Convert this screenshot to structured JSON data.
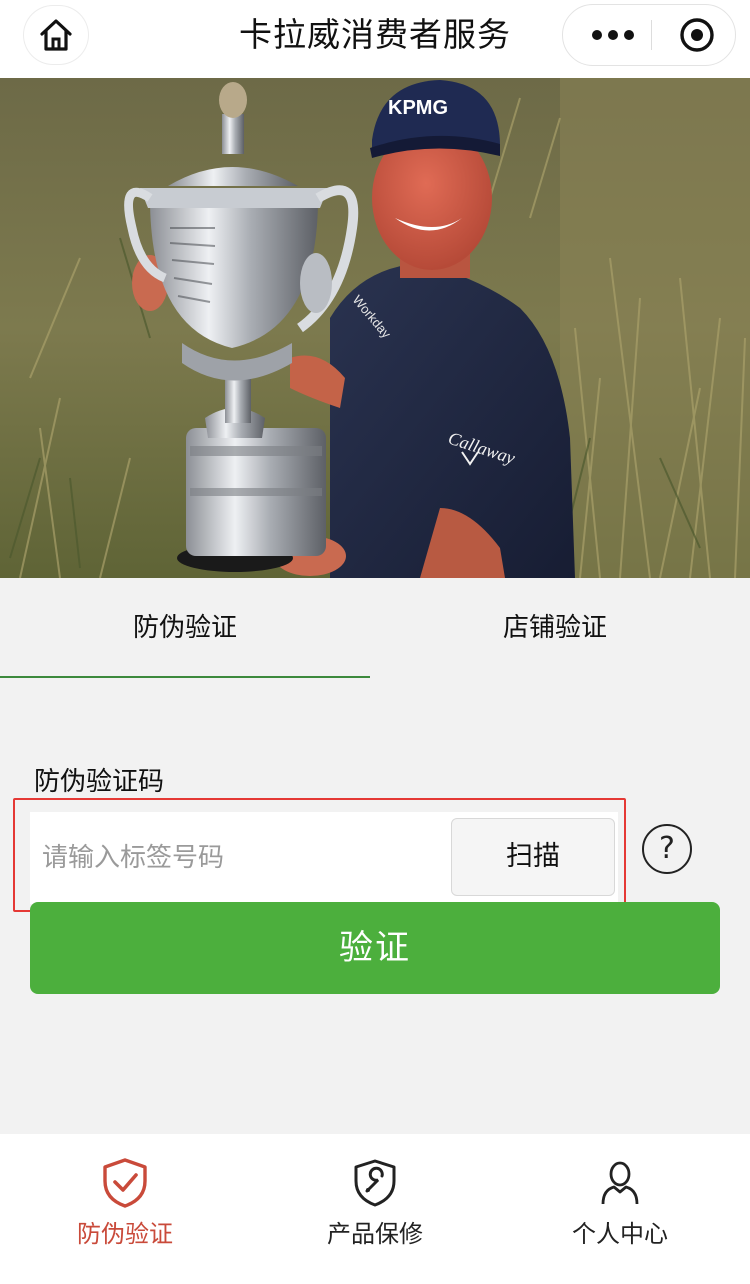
{
  "header": {
    "title": "卡拉威消费者服务",
    "home_icon": "home-icon",
    "more_icon": "more-dots-icon",
    "close_icon": "mini-program-close-icon"
  },
  "hero": {
    "cap_logo": "KPMG",
    "shirt_logo": "Callaway"
  },
  "tabs": {
    "items": [
      {
        "label": "防伪验证",
        "active": true
      },
      {
        "label": "店铺验证",
        "active": false
      }
    ],
    "active_color": "#3d8a3d"
  },
  "form": {
    "label": "防伪验证码",
    "placeholder": "请输入标签号码",
    "value": "",
    "scan_label": "扫描",
    "help_label": "?",
    "verify_label": "验证",
    "verify_color": "#4caf3d",
    "highlight_color": "#e53935"
  },
  "tabbar": {
    "items": [
      {
        "label": "防伪验证",
        "icon": "shield-check-icon",
        "active": true
      },
      {
        "label": "产品保修",
        "icon": "wrench-shield-icon",
        "active": false
      },
      {
        "label": "个人中心",
        "icon": "user-icon",
        "active": false
      }
    ],
    "active_color": "#c94a3a"
  }
}
